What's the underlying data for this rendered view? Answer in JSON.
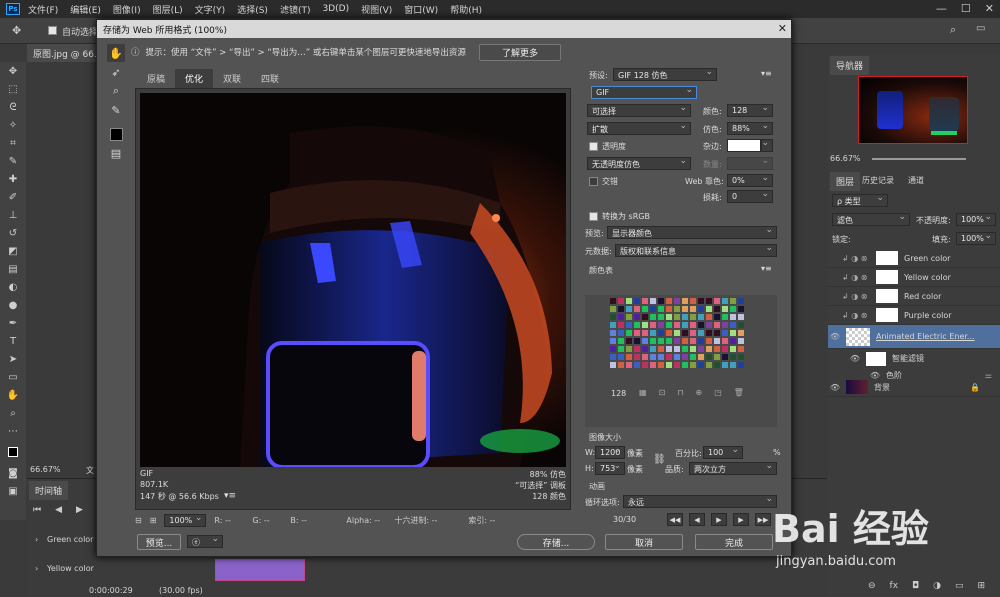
{
  "menubar": {
    "logo": "Ps",
    "items": [
      "文件(F)",
      "编辑(E)",
      "图像(I)",
      "图层(L)",
      "文字(Y)",
      "选择(S)",
      "滤镜(T)",
      "3D(D)",
      "视图(V)",
      "窗口(W)",
      "帮助(H)"
    ],
    "controls": [
      "—",
      "☐",
      "✕"
    ]
  },
  "optbar": {
    "auto_select": "自动选择"
  },
  "doc_tab": "原图.jpg @ 66.7",
  "zoom_left": "66.67%",
  "doc_label": "文",
  "dialog": {
    "title": "存储为 Web 所用格式 (100%)",
    "hint": "提示：使用 “文件” > “导出” > “导出为…” 或右键单击某个图层可更快速地导出资源",
    "learn_more": "了解更多",
    "tabs": [
      "原稿",
      "优化",
      "双联",
      "四联"
    ],
    "info": {
      "format": "GIF",
      "size": "807.1K",
      "time": "147 秒 @ 56.6 Kbps",
      "dither": "88% 仿色",
      "palette": "“可选择” 调板",
      "colors": "128 颜色"
    },
    "status": {
      "zoom": "100%",
      "r": "R: --",
      "g": "G: --",
      "b": "B: --",
      "alpha": "Alpha: --",
      "hex": "十六进制: --",
      "index": "索引: --"
    },
    "settings": {
      "preset_label": "预设:",
      "preset_value": "GIF 128 仿色",
      "format": "GIF",
      "reduction": "可选择",
      "colors_label": "颜色:",
      "colors_value": "128",
      "dither_algo": "扩散",
      "dither_label": "仿色:",
      "dither_value": "88%",
      "transparency": "透明度",
      "matte_label": "杂边:",
      "trans_dither": "无透明度仿色",
      "amount_label": "数量:",
      "interlaced": "交错",
      "websnap_label": "Web 靠色:",
      "websnap_value": "0%",
      "lossy_label": "损耗:",
      "lossy_value": "0",
      "srgb": "转换为 sRGB",
      "preview_label": "预览:",
      "preview_value": "显示器颜色",
      "metadata_label": "元数据:",
      "metadata_value": "版权和联系信息",
      "color_table": "颜色表",
      "color_count": "128"
    },
    "image_size": {
      "title": "图像大小",
      "w_label": "W:",
      "w_value": "1200",
      "h_label": "H:",
      "h_value": "753",
      "unit": "像素",
      "percent_label": "百分比:",
      "percent_value": "100",
      "percent_unit": "%",
      "quality_label": "品质:",
      "quality_value": "两次立方"
    },
    "animation": {
      "title": "动画",
      "loop_label": "循环选项:",
      "loop_value": "永远",
      "frame": "30/30"
    },
    "buttons": {
      "preview": "预览...",
      "save": "存储...",
      "cancel": "取消",
      "done": "完成"
    }
  },
  "navigator": {
    "title": "导航器",
    "zoom": "66.67%"
  },
  "layers": {
    "tabs": [
      "图层",
      "历史记录",
      "通道"
    ],
    "kind": "ρ 类型",
    "blend": "滤色",
    "opacity_label": "不透明度:",
    "opacity": "100%",
    "lock_label": "锁定:",
    "fill_label": "填充:",
    "fill": "100%",
    "items": [
      {
        "name": "Green color"
      },
      {
        "name": "Yellow color"
      },
      {
        "name": "Red color"
      },
      {
        "name": "Purple color"
      },
      {
        "name": "Animated Electric Ener..."
      },
      {
        "name": "智能滤镜"
      },
      {
        "name": "色阶"
      },
      {
        "name": "背景"
      }
    ]
  },
  "timeline": {
    "title": "时间轴",
    "tracks": [
      "Green color",
      "Yellow color"
    ],
    "timecode": "0:00:00:29",
    "fps": "(30.00 fps)"
  },
  "watermark": {
    "brand": "Bai 经验",
    "url": "jingyan.baidu.com"
  }
}
